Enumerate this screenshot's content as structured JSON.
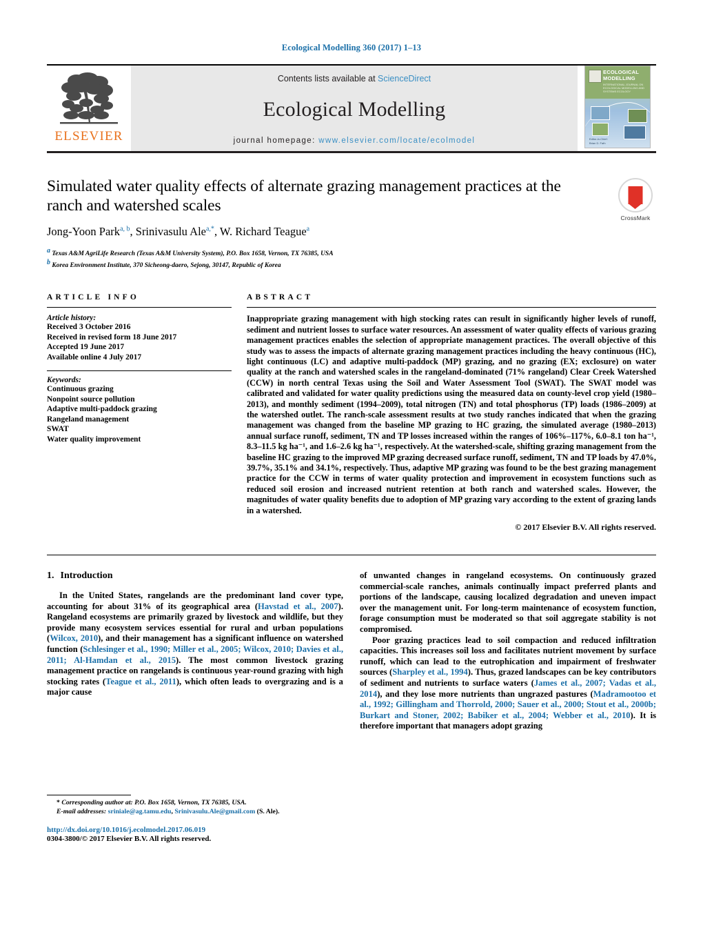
{
  "running_head": "Ecological Modelling 360 (2017) 1–13",
  "masthead": {
    "contents_prefix": "Contents lists available at ",
    "contents_link": "ScienceDirect",
    "journal_title": "Ecological Modelling",
    "homepage_label": "journal homepage:",
    "homepage_url": "www.elsevier.com/locate/ecolmodel",
    "publisher_logo_text": "ELSEVIER",
    "cover": {
      "title_line1": "ECOLOGICAL",
      "title_line2": "MODELLING",
      "subtitle": "INTERNATIONAL JOURNAL ON ECOLOGICAL MODELLING AND SYSTEMS ECOLOGY",
      "footer_line1": "Editor-in-Chief:",
      "footer_line2": "Brian D. Fath"
    }
  },
  "article": {
    "title": "Simulated water quality effects of alternate grazing management practices at the ranch and watershed scales",
    "authors": [
      {
        "name": "Jong-Yoon Park",
        "marks": "a, b"
      },
      {
        "name": "Srinivasulu Ale",
        "marks": "a,*"
      },
      {
        "name": "W. Richard Teague",
        "marks": "a"
      }
    ],
    "affiliations": [
      {
        "mark": "a",
        "text": "Texas A&M AgriLife Research (Texas A&M University System), P.O. Box 1658, Vernon, TX 76385, USA"
      },
      {
        "mark": "b",
        "text": "Korea Environment Institute, 370 Sicheong-daero, Sejong, 30147, Republic of Korea"
      }
    ],
    "crossmark_label": "CrossMark"
  },
  "article_info": {
    "heading": "ARTICLE INFO",
    "history_label": "Article history:",
    "history": [
      "Received 3 October 2016",
      "Received in revised form 18 June 2017",
      "Accepted 19 June 2017",
      "Available online 4 July 2017"
    ],
    "keywords_label": "Keywords:",
    "keywords": [
      "Continuous grazing",
      "Nonpoint source pollution",
      "Adaptive multi-paddock grazing",
      "Rangeland management",
      "SWAT",
      "Water quality improvement"
    ]
  },
  "abstract": {
    "heading": "ABSTRACT",
    "text": "Inappropriate grazing management with high stocking rates can result in significantly higher levels of runoff, sediment and nutrient losses to surface water resources. An assessment of water quality effects of various grazing management practices enables the selection of appropriate management practices. The overall objective of this study was to assess the impacts of alternate grazing management practices including the heavy continuous (HC), light continuous (LC) and adaptive multi-paddock (MP) grazing, and no grazing (EX; exclosure) on water quality at the ranch and watershed scales in the rangeland-dominated (71% rangeland) Clear Creek Watershed (CCW) in north central Texas using the Soil and Water Assessment Tool (SWAT). The SWAT model was calibrated and validated for water quality predictions using the measured data on county-level crop yield (1980–2013), and monthly sediment (1994–2009), total nitrogen (TN) and total phosphorus (TP) loads (1986–2009) at the watershed outlet. The ranch-scale assessment results at two study ranches indicated that when the grazing management was changed from the baseline MP grazing to HC grazing, the simulated average (1980–2013) annual surface runoff, sediment, TN and TP losses increased within the ranges of 106%–117%, 6.0–8.1 ton ha⁻¹, 8.3–11.5 kg ha⁻¹, and 1.6–2.6 kg ha⁻¹, respectively. At the watershed-scale, shifting grazing management from the baseline HC grazing to the improved MP grazing decreased surface runoff, sediment, TN and TP loads by 47.0%, 39.7%, 35.1% and 34.1%, respectively. Thus, adaptive MP grazing was found to be the best grazing management practice for the CCW in terms of water quality protection and improvement in ecosystem functions such as reduced soil erosion and increased nutrient retention at both ranch and watershed scales. However, the magnitudes of water quality benefits due to adoption of MP grazing vary according to the extent of grazing lands in a watershed.",
    "copyright": "© 2017 Elsevier B.V. All rights reserved."
  },
  "introduction": {
    "number": "1.",
    "title": "Introduction",
    "left_paragraph_html": "In the United States, rangelands are the predominant land cover type, accounting for about 31% of its geographical area (<span class=\"ref\">Havstad et al., 2007</span>). Rangeland ecosystems are primarily grazed by livestock and wildlife, but they provide many ecosystem services essential for rural and urban populations (<span class=\"ref\">Wilcox, 2010</span>), and their management has a significant influence on watershed function (<span class=\"ref\">Schlesinger et al., 1990; Miller et al., 2005; Wilcox, 2010; Davies et al., 2011; Al-Hamdan et al., 2015</span>). The most common livestock grazing management practice on rangelands is continuous year-round grazing with high stocking rates (<span class=\"ref\">Teague et al., 2011</span>), which often leads to overgrazing and is a major cause",
    "right_paragraph1_html": "of unwanted changes in rangeland ecosystems. On continuously grazed commercial-scale ranches, animals continually impact preferred plants and portions of the landscape, causing localized degradation and uneven impact over the management unit. For long-term maintenance of ecosystem function, forage consumption must be moderated so that soil aggregate stability is not compromised.",
    "right_paragraph2_html": "Poor grazing practices lead to soil compaction and reduced infiltration capacities. This increases soil loss and facilitates nutrient movement by surface runoff, which can lead to the eutrophication and impairment of freshwater sources (<span class=\"ref\">Sharpley et al., 1994</span>). Thus, grazed landscapes can be key contributors of sediment and nutrients to surface waters (<span class=\"ref\">James et al., 2007; Vadas et al., 2014</span>), and they lose more nutrients than ungrazed pastures (<span class=\"ref\">Madramootoo et al., 1992; Gillingham and Thorrold, 2000; Sauer et al., 2000; Stout et al., 2000b; Burkart and Stoner, 2002; Babiker et al., 2004; Webber et al., 2010</span>). It is therefore important that managers adopt grazing"
  },
  "footnotes": {
    "corresponding_html": "* <span class=\"ital\">Corresponding author at: P.O. Box 1658, Vernon, TX 76385, USA.</span>",
    "email_html": "<span class=\"ital\">E-mail addresses:</span> <span class=\"ref\">sriniale@ag.tamu.edu</span>, <span class=\"ref\">Srinivasulu.Ale@gmail.com</span> (S. Ale).",
    "doi": "http://dx.doi.org/10.1016/j.ecolmodel.2017.06.019",
    "issn": "0304-3800/© 2017 Elsevier B.V. All rights reserved."
  }
}
